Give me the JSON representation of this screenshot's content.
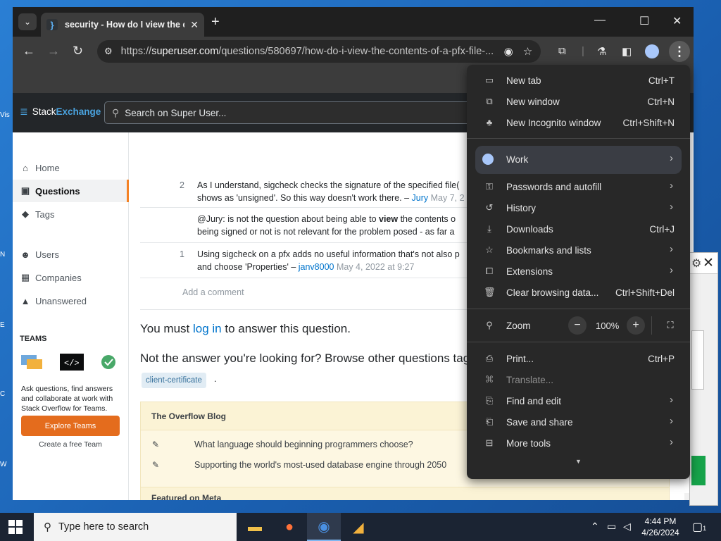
{
  "desktop": {
    "edge_letters": [
      "Vis",
      "N",
      "E",
      "C",
      "W"
    ]
  },
  "browser": {
    "tab": {
      "title": "security - How do I view the co",
      "favicon": "}"
    },
    "url": {
      "domain": "superuser.com",
      "prefix": "https://",
      "path": "/questions/580697/how-do-i-view-the-contents-of-a-pfx-file-..."
    }
  },
  "site": {
    "logo_stack": "Stack",
    "logo_exchange": "Exchange",
    "search_placeholder": "Search on Super User...",
    "nav": [
      {
        "label": "Home"
      },
      {
        "label": "Questions"
      },
      {
        "label": "Tags"
      },
      {
        "label": "Users"
      },
      {
        "label": "Companies"
      },
      {
        "label": "Unanswered"
      }
    ],
    "teams": {
      "heading": "TEAMS",
      "text": "Ask questions, find answers and collaborate at work with Stack Overflow for Teams.",
      "button": "Explore Teams",
      "free": "Create a free Team"
    },
    "comments": [
      {
        "score": "2",
        "line1": "As I understand, sigcheck checks the signature of the specified file(",
        "line2_text": "shows as 'unsigned'. So this way doesn't work there. – ",
        "user": "Jury",
        "date": " May 7, 2"
      },
      {
        "score": "",
        "line1_pre": "@Jury: is not the question about being able to ",
        "line1_bold": "view",
        "line1_post": " the contents o",
        "line2_text": "being signed or not is not relevant for the problem posed - as far a"
      },
      {
        "score": "1",
        "line1": "Using sigcheck on a pfx adds no useful information that's not also p",
        "line2_text": "and choose 'Properties' – ",
        "user": "janv8000",
        "date": " May 4, 2022 at 9:27"
      }
    ],
    "add_comment": "Add a comment",
    "must_login_pre": "You must ",
    "must_login_link": "log in",
    "must_login_post": " to answer this question.",
    "not_answer": "Not the answer you're looking for? Browse other questions tag",
    "tag": "client-certificate",
    "tag_trail": ".",
    "blog": {
      "heading": "The Overflow Blog",
      "items": [
        "What language should beginning programmers choose?",
        "Supporting the world's most-used database engine through 2050"
      ],
      "meta_heading": "Featured on Meta"
    }
  },
  "menu": {
    "items_top": [
      {
        "label": "New tab",
        "shortcut": "Ctrl+T"
      },
      {
        "label": "New window",
        "shortcut": "Ctrl+N"
      },
      {
        "label": "New Incognito window",
        "shortcut": "Ctrl+Shift+N"
      }
    ],
    "profile": "Work",
    "items_mid": [
      {
        "label": "Passwords and autofill",
        "shortcut": ""
      },
      {
        "label": "History",
        "shortcut": ""
      },
      {
        "label": "Downloads",
        "shortcut": "Ctrl+J"
      },
      {
        "label": "Bookmarks and lists",
        "shortcut": ""
      },
      {
        "label": "Extensions",
        "shortcut": ""
      },
      {
        "label": "Clear browsing data...",
        "shortcut": "Ctrl+Shift+Del"
      }
    ],
    "zoom_label": "Zoom",
    "zoom_value": "100%",
    "items_bottom": [
      {
        "label": "Print...",
        "shortcut": "Ctrl+P"
      },
      {
        "label": "Translate...",
        "shortcut": ""
      },
      {
        "label": "Find and edit",
        "shortcut": ""
      },
      {
        "label": "Save and share",
        "shortcut": ""
      },
      {
        "label": "More tools",
        "shortcut": ""
      }
    ]
  },
  "taskbar": {
    "search_placeholder": "Type here to search",
    "time": "4:44 PM",
    "date": "4/26/2024",
    "notification_count": "1"
  }
}
